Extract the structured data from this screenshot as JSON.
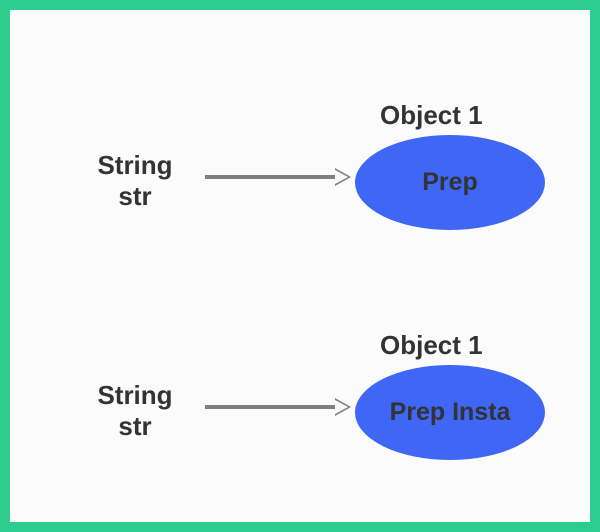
{
  "diagrams": [
    {
      "var_type": "String",
      "var_name": "str",
      "object_title": "Object 1",
      "object_value": "Prep"
    },
    {
      "var_type": "String",
      "var_name": "str",
      "object_title": "Object 1",
      "object_value": "Prep Insta"
    }
  ],
  "colors": {
    "border": "#2ecc8f",
    "ellipse": "#3f66f4",
    "text": "#333333",
    "arrow": "#808080"
  }
}
